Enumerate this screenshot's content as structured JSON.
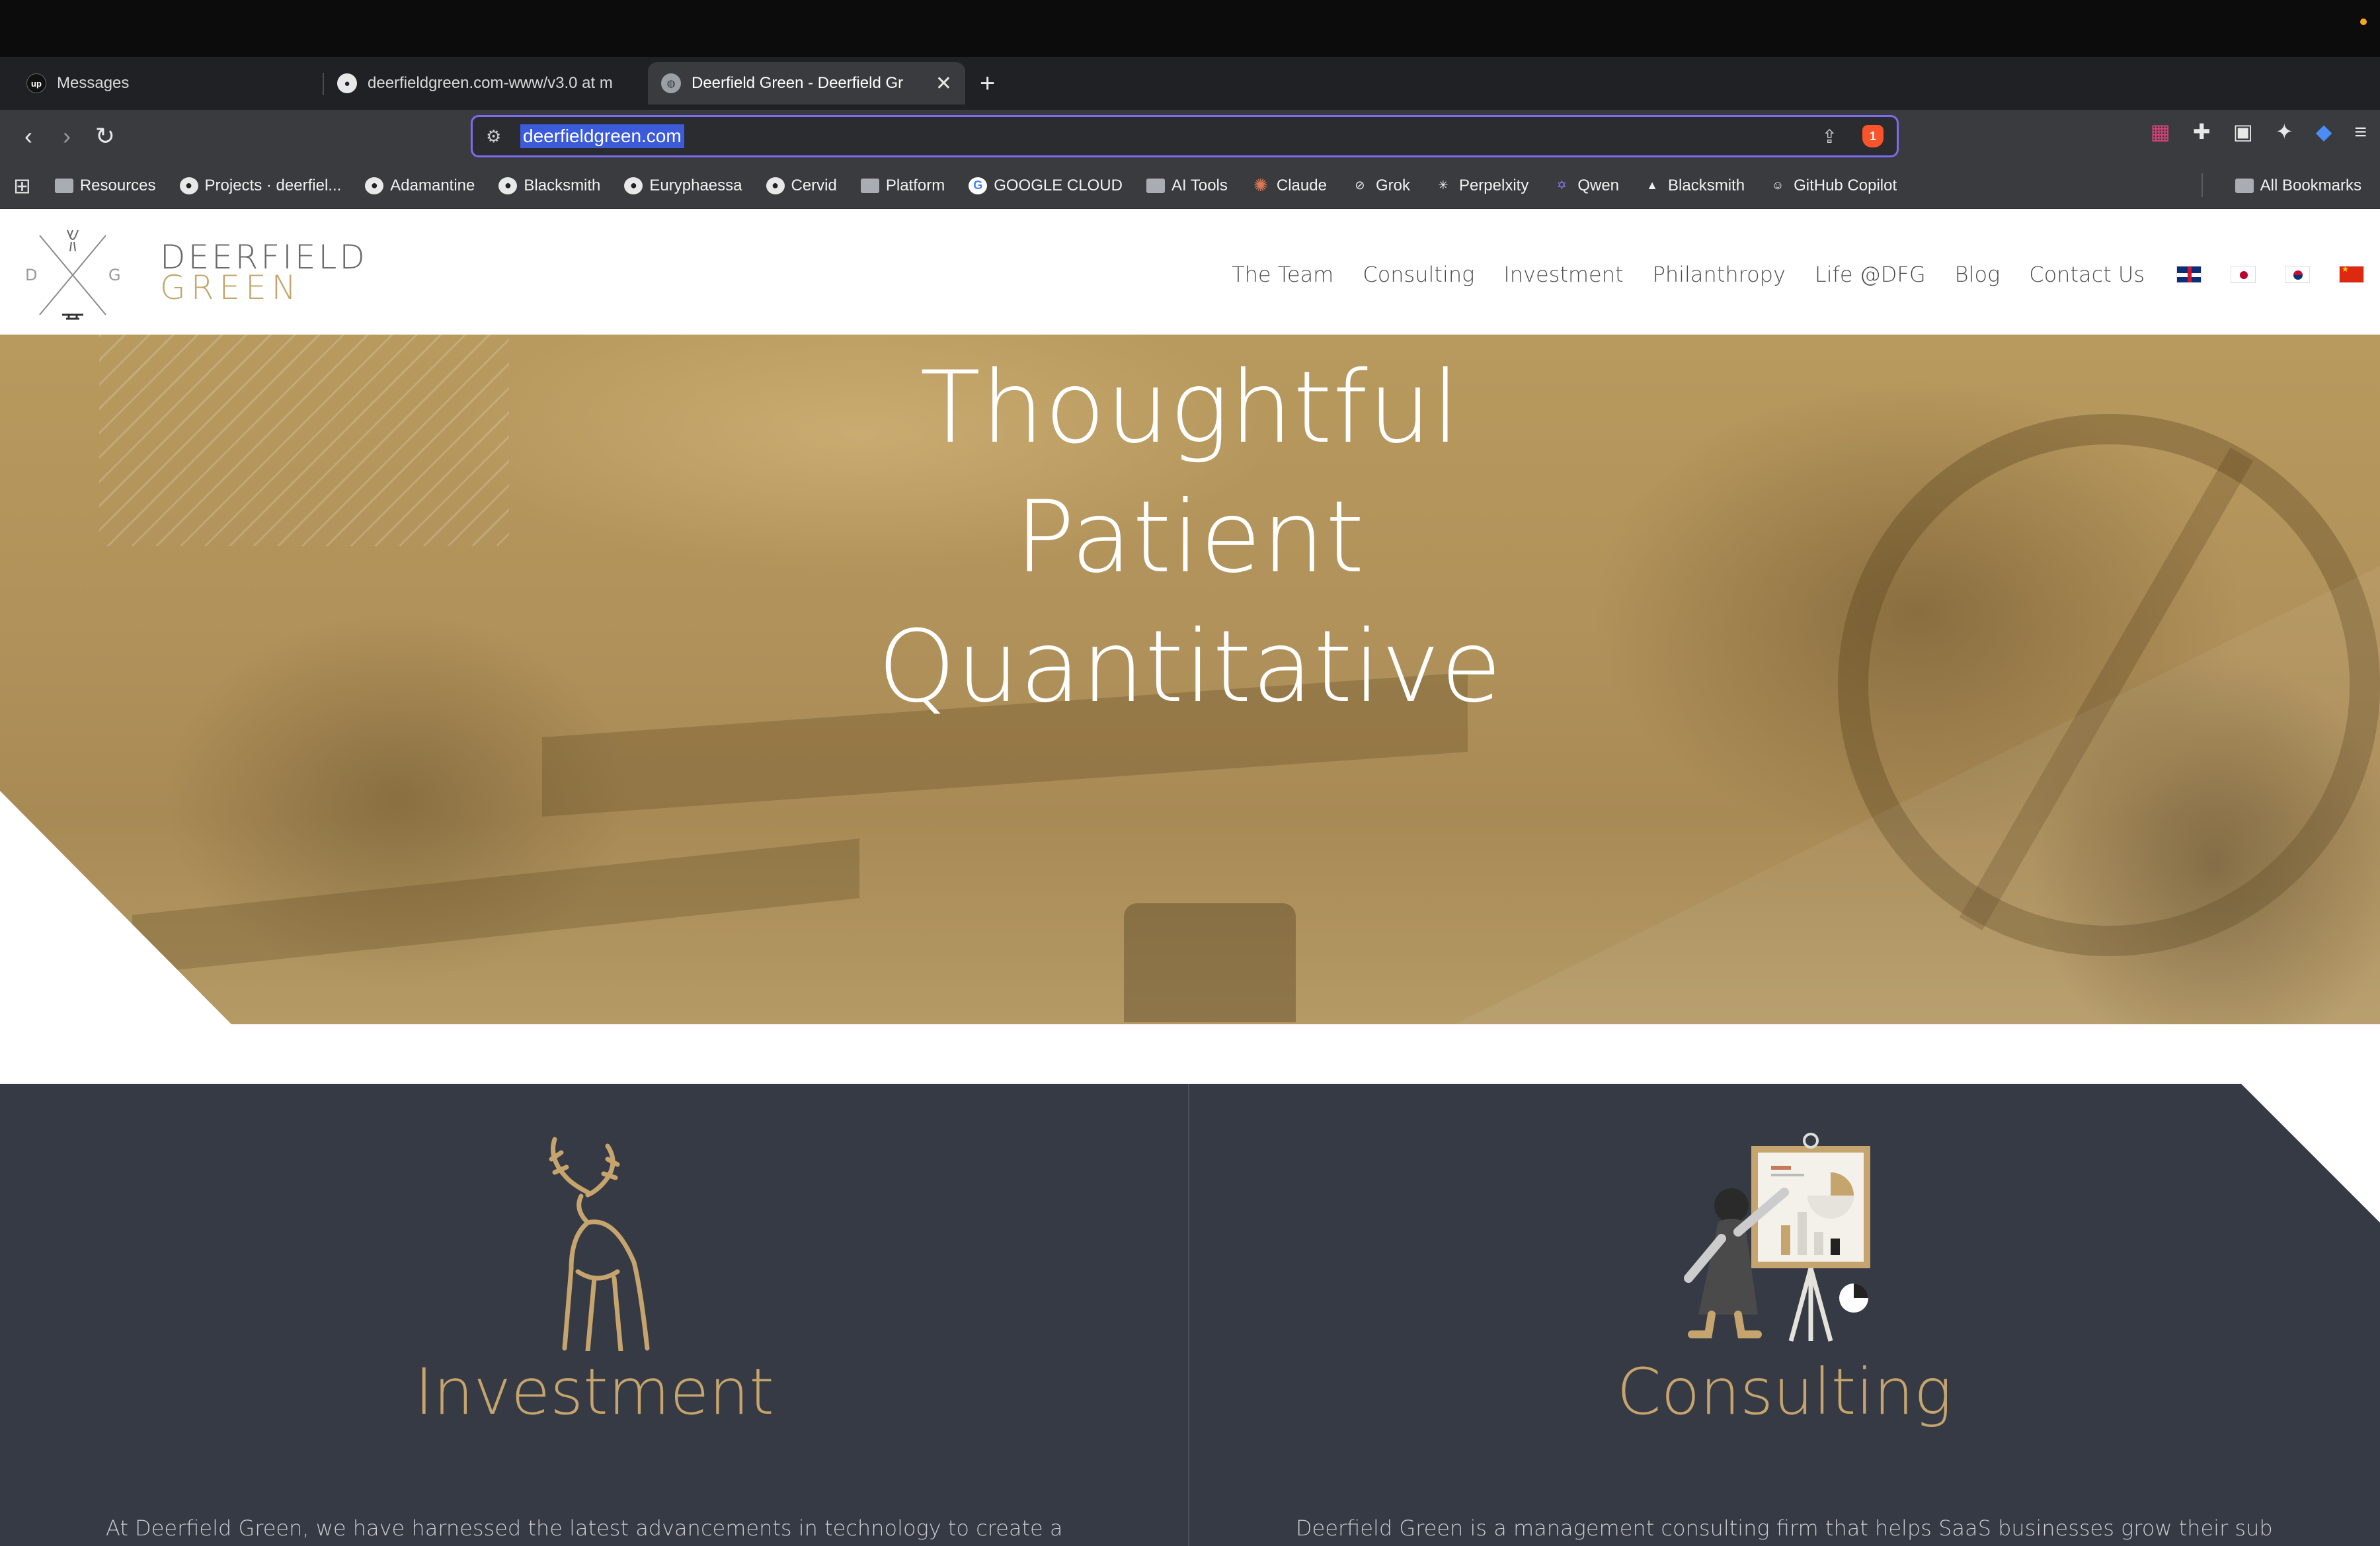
{
  "browser": {
    "tabs": [
      {
        "favicon": "up-icon",
        "title": "Messages"
      },
      {
        "favicon": "github-icon",
        "title": "deerfieldgreen.com-www/v3.0 at m"
      },
      {
        "favicon": "globe-icon",
        "title": "Deerfield Green - Deerfield Gr",
        "active": true
      }
    ],
    "new_tab": "+",
    "close": "✕",
    "url": "deerfieldgreen.com",
    "brave_badge": "1",
    "bookmarks": [
      {
        "icon": "folder-icon",
        "label": "Resources"
      },
      {
        "icon": "github-icon",
        "label": "Projects · deerfiel..."
      },
      {
        "icon": "github-icon",
        "label": "Adamantine"
      },
      {
        "icon": "github-icon",
        "label": "Blacksmith"
      },
      {
        "icon": "github-icon",
        "label": "Euryphaessa"
      },
      {
        "icon": "github-icon",
        "label": "Cervid"
      },
      {
        "icon": "folder-icon",
        "label": "Platform"
      },
      {
        "icon": "google-icon",
        "label": "GOOGLE CLOUD"
      },
      {
        "icon": "folder-icon",
        "label": "AI Tools"
      },
      {
        "icon": "claude-icon",
        "label": "Claude"
      },
      {
        "icon": "grok-icon",
        "label": "Grok"
      },
      {
        "icon": "perplexity-icon",
        "label": "Perpelxity"
      },
      {
        "icon": "qwen-icon",
        "label": "Qwen"
      },
      {
        "icon": "triangle-icon",
        "label": "Blacksmith"
      },
      {
        "icon": "copilot-icon",
        "label": "GitHub Copilot"
      }
    ],
    "all_bookmarks": "All Bookmarks"
  },
  "site": {
    "brand_line1": "DEERFIELD",
    "brand_line2": "GREEN",
    "logo_letters": {
      "left": "D",
      "right": "G"
    },
    "nav": [
      "The Team",
      "Consulting",
      "Investment",
      "Philanthropy",
      "Life @DFG",
      "Blog",
      "Contact Us"
    ],
    "flags": [
      "uk-flag",
      "japan-flag",
      "korea-flag",
      "china-flag"
    ],
    "hero": [
      "Thoughtful",
      "Patient",
      "Quantitative"
    ],
    "services": [
      {
        "heading": "Investment",
        "icon": "deer-icon",
        "text": "At Deerfield Green, we have harnessed the latest advancements in technology to create a"
      },
      {
        "heading": "Consulting",
        "icon": "presentation-icon",
        "text": "Deerfield Green is a management consulting firm that helps SaaS businesses grow their subscription"
      }
    ]
  },
  "colors": {
    "gold": "#c5a46d",
    "dark": "#363a44",
    "url_focus": "#7b6cf0"
  }
}
